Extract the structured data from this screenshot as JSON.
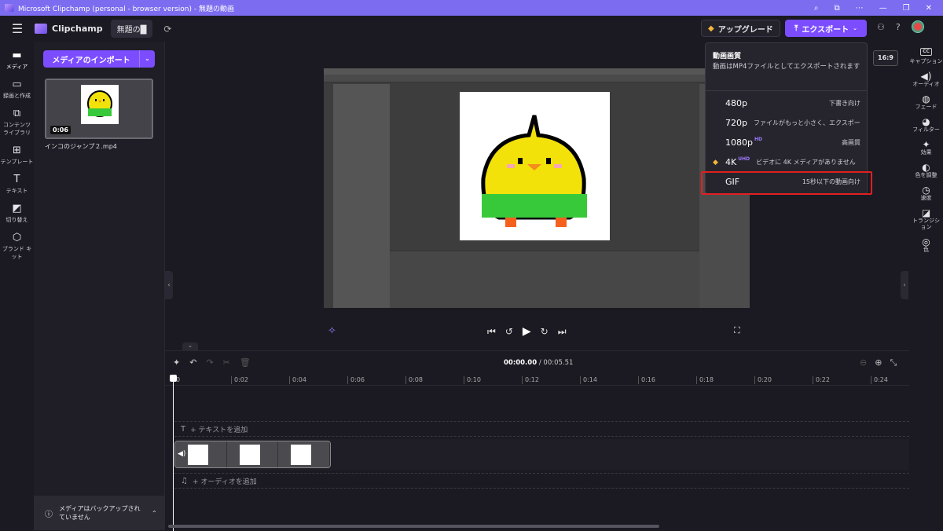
{
  "window": {
    "title": "Microsoft Clipchamp (personal - browser version) - 無題の動画"
  },
  "topbar": {
    "brand": "Clipchamp",
    "project_name": "無題の█",
    "upgrade_label": "アップグレード",
    "export_label": "エクスポート"
  },
  "left_rail": {
    "items": [
      {
        "label": "メディア",
        "icon": "folder-icon"
      },
      {
        "label": "録画と作成",
        "icon": "video-camera-icon"
      },
      {
        "label": "コンテンツ ライブラリ",
        "icon": "library-icon"
      },
      {
        "label": "テンプレート",
        "icon": "templates-icon"
      },
      {
        "label": "テキスト",
        "icon": "text-icon"
      },
      {
        "label": "切り替え",
        "icon": "transitions-icon"
      },
      {
        "label": "ブランド キット",
        "icon": "brand-kit-icon"
      }
    ]
  },
  "media_panel": {
    "import_label": "メディアのインポート",
    "thumb_duration": "0:06",
    "file_name": "インコのジャンプ２.mp4",
    "backup_message": "メディアはバックアップされていません"
  },
  "preview": {
    "aspect_ratio": "16:9"
  },
  "export_menu": {
    "title": "動画画質",
    "description": "動画はMP4ファイルとしてエクスポートされます",
    "options": [
      {
        "res": "480p",
        "sup": "",
        "note": "下書き向け"
      },
      {
        "res": "720p",
        "sup": "",
        "note": "ファイルがもっと小さく、エクスポートが"
      },
      {
        "res": "1080p",
        "sup": "HD",
        "note": "高画質"
      },
      {
        "res": "4K",
        "sup": "UHD",
        "note": "ビデオに 4K メディアがありません"
      },
      {
        "res": "GIF",
        "sup": "",
        "note": "15秒以下の動画向け"
      }
    ]
  },
  "right_rail": {
    "items": [
      {
        "label": "キャプション",
        "icon": "captions-icon"
      },
      {
        "label": "オーディオ",
        "icon": "audio-icon"
      },
      {
        "label": "フェード",
        "icon": "fade-icon"
      },
      {
        "label": "フィルター",
        "icon": "filter-icon"
      },
      {
        "label": "効果",
        "icon": "effects-icon"
      },
      {
        "label": "色を調整",
        "icon": "adjust-color-icon"
      },
      {
        "label": "速度",
        "icon": "speed-icon"
      },
      {
        "label": "トランジション",
        "icon": "transition-icon"
      },
      {
        "label": "色",
        "icon": "color-icon"
      }
    ]
  },
  "timeline": {
    "current_time": "00:00.00",
    "total_time": "00:05.51",
    "ticks": [
      "0",
      "0:02",
      "0:04",
      "0:06",
      "0:08",
      "0:10",
      "0:12",
      "0:14",
      "0:16",
      "0:18",
      "0:20",
      "0:22",
      "0:24"
    ],
    "text_track_label": "+ テキストを追加",
    "audio_track_label": "+ オーディオを追加"
  },
  "colors": {
    "accent": "#7c4dff",
    "titlebar": "#7b6cf0",
    "highlight": "#e02020"
  }
}
